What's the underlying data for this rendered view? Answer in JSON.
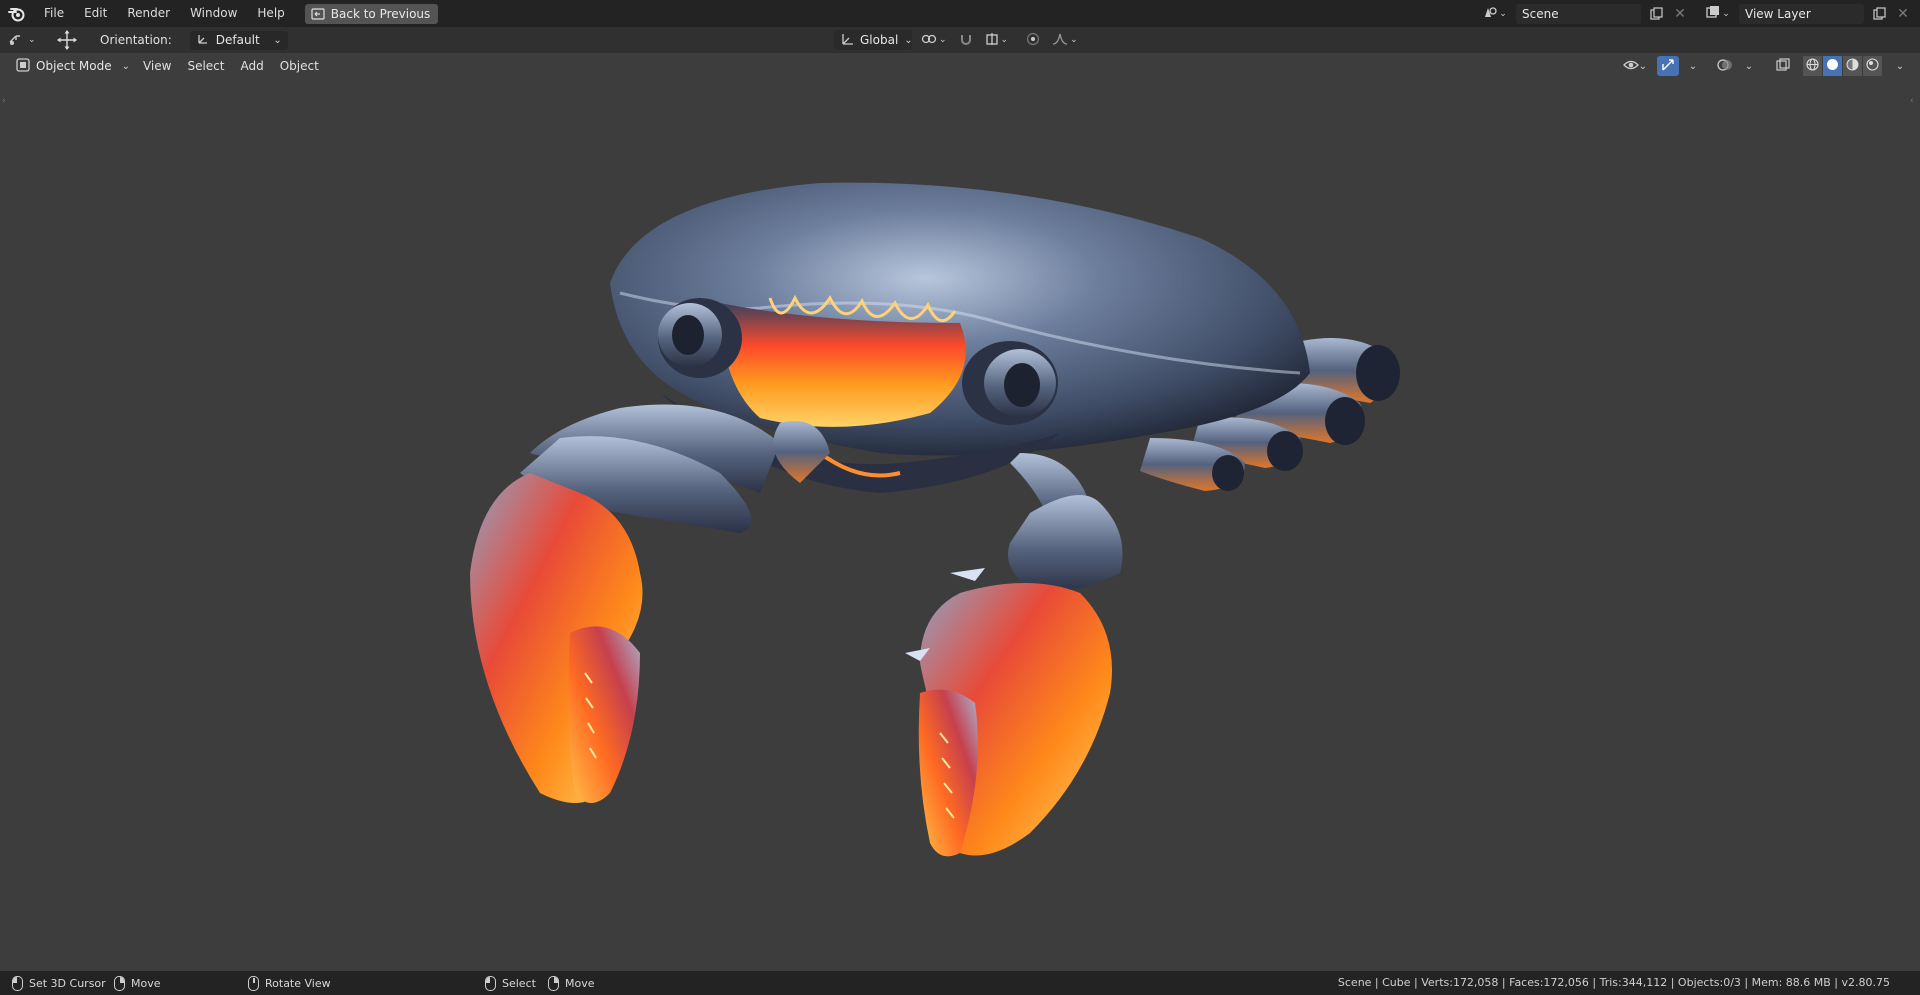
{
  "topbar": {
    "menus": [
      "File",
      "Edit",
      "Render",
      "Window",
      "Help"
    ],
    "back_button": "Back to Previous",
    "scene": "Scene",
    "view_layer": "View Layer"
  },
  "toolheader": {
    "orientation_label": "Orientation:",
    "orientation_value": "Default",
    "transform_space": "Global"
  },
  "viewheader": {
    "mode": "Object Mode",
    "menus": [
      "View",
      "Select",
      "Add",
      "Object"
    ]
  },
  "statusbar": {
    "left_click": "Set 3D Cursor",
    "right_drag": "Move",
    "middle": "Rotate View",
    "select": "Select",
    "move": "Move",
    "stats": "Scene | Cube | Verts:172,058 | Faces:172,056 | Tris:344,112 | Objects:0/3 | Mem: 88.6 MB | v2.80.75"
  },
  "colors": {
    "accent": "#4772b3",
    "viewport_bg": "#3d3d3d",
    "topbar_bg": "#232323"
  },
  "icons": [
    "blender-logo-icon",
    "back-icon",
    "scene-icon",
    "view-layer-icon",
    "copy-icon",
    "close-icon",
    "editor-type-icon",
    "move-tool-icon",
    "orientation-icon",
    "global-axis-icon",
    "pivot-icon",
    "snap-icon",
    "proportional-icon",
    "falloff-icon",
    "object-mode-icon",
    "visibility-icon",
    "gizmo-icon",
    "overlay-icon",
    "xray-icon",
    "wireframe-icon",
    "solid-icon",
    "material-icon",
    "rendered-icon"
  ]
}
